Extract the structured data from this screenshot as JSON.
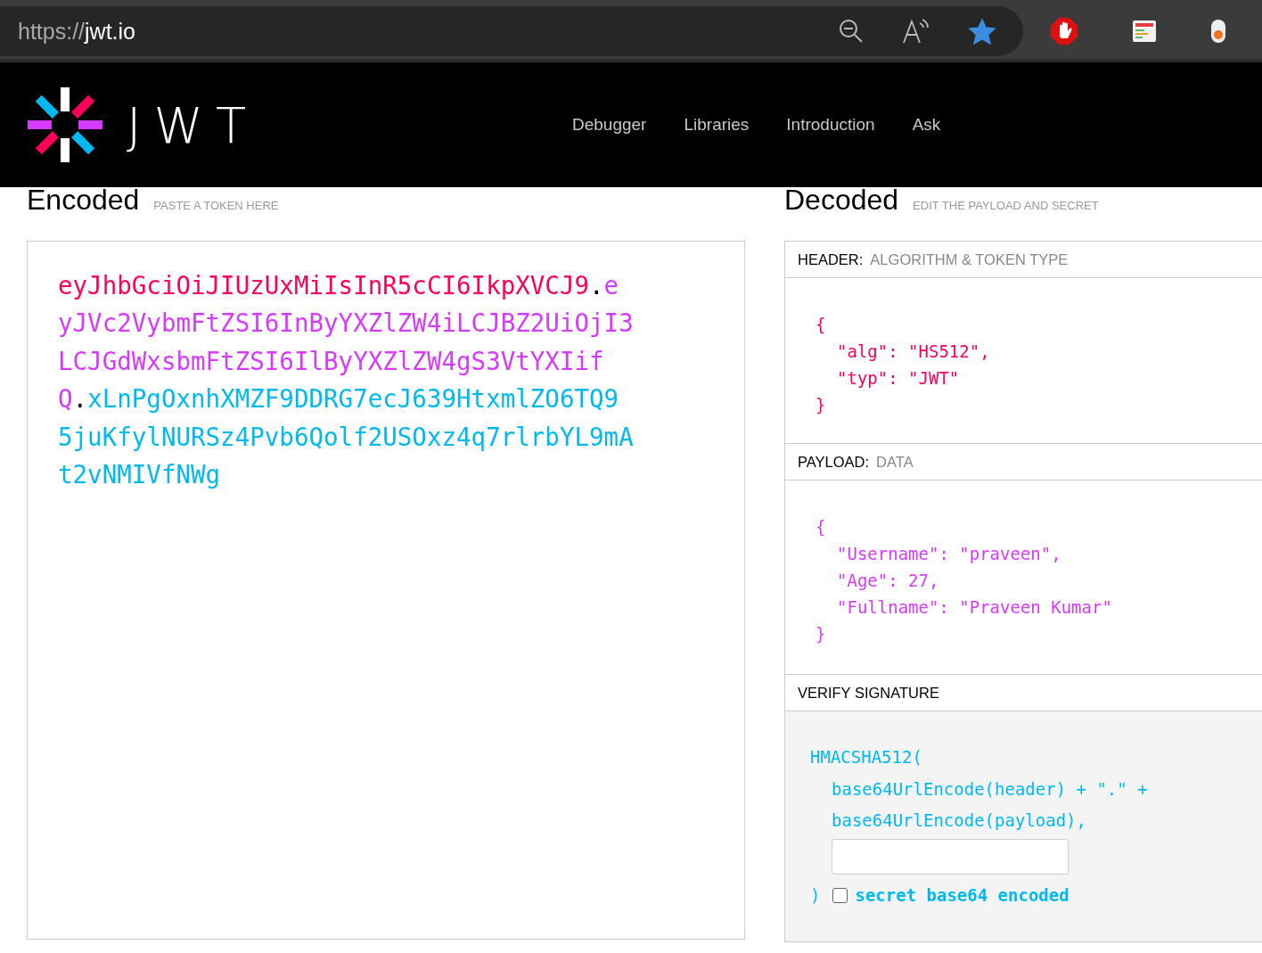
{
  "browser": {
    "url_scheme": "https://",
    "url_host": "jwt.io",
    "star_on": true
  },
  "nav": {
    "logo_text": "JWT",
    "items": [
      "Debugger",
      "Libraries",
      "Introduction",
      "Ask"
    ]
  },
  "encoded": {
    "title": "Encoded",
    "hint": "PASTE A TOKEN HERE",
    "token": [
      {
        "kind": "header",
        "text": "eyJhbGciOiJIUzUxMiIsInR5cCI6IkpXVCJ9"
      },
      {
        "kind": "dot",
        "text": "."
      },
      {
        "kind": "payload",
        "text": "eyJVc2VybmFtZSI6InByYXZlZW4iLCJBZ2UiOjI3LCJGdWxsbmFtZSI6IlByYXZlZW4gS3VtYXIifQ"
      },
      {
        "kind": "dot",
        "text": "."
      },
      {
        "kind": "signature",
        "text": "xLnPgOxnhXMZF9DDRG7ecJ639HtxmlZO6TQ95juKfylNURSz4Pvb6Qolf2USOxz4q7rlrbYL9mAt2vNMIVfNWg"
      }
    ]
  },
  "decoded": {
    "title": "Decoded",
    "hint": "EDIT THE PAYLOAD AND SECRET",
    "header": {
      "label": "HEADER:",
      "hint": "ALGORITHM & TOKEN TYPE",
      "open": "{",
      "entries": [
        "\"alg\": \"HS512\",",
        "\"typ\": \"JWT\""
      ],
      "close": "}"
    },
    "payload": {
      "label": "PAYLOAD:",
      "hint": "DATA",
      "open": "{",
      "entries": [
        "\"Username\": \"praveen\",",
        "\"Age\": 27,",
        "\"Fullname\": \"Praveen Kumar\""
      ],
      "close": "}"
    },
    "signature": {
      "label": "VERIFY SIGNATURE",
      "function": "HMACSHA512(",
      "args": [
        "base64UrlEncode(header) + \".\" +",
        "base64UrlEncode(payload),"
      ],
      "close": ")",
      "checkbox": {
        "label": "secret base64 encoded",
        "checked": false
      }
    }
  }
}
